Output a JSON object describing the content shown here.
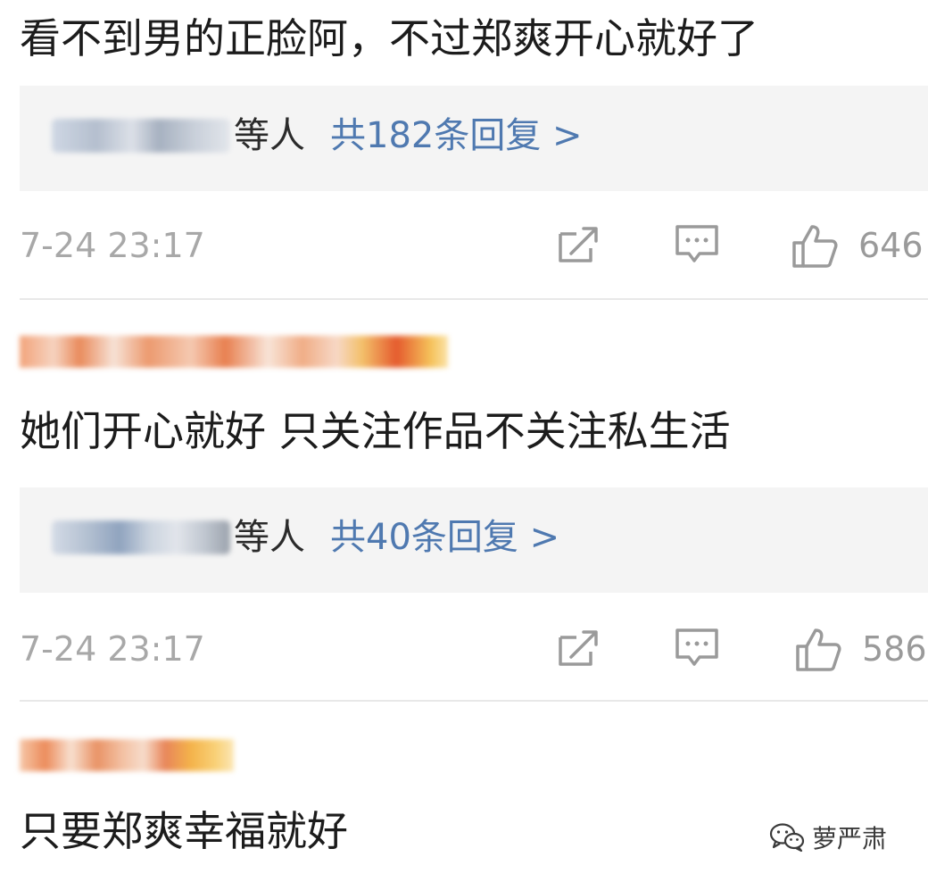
{
  "comments": [
    {
      "text": "看不到男的正脸阿，不过郑爽开心就好了",
      "reply_suffix": "等人",
      "reply_link": "共182条回复 >",
      "timestamp": "7-24 23:17",
      "likes": "646"
    },
    {
      "text": "她们开心就好  只关注作品不关注私生活",
      "reply_suffix": "等人",
      "reply_link": "共40条回复 >",
      "timestamp": "7-24 23:17",
      "likes": "586"
    },
    {
      "text": "只要郑爽幸福就好"
    }
  ],
  "icons": {
    "repost": "repost-icon",
    "comment": "comment-icon",
    "like": "thumbs-up-icon",
    "watermark": "wechat-icon"
  },
  "colors": {
    "link": "#4f79b0",
    "meta": "#a8a8a8",
    "reply_bg": "#f4f4f4"
  },
  "watermark": {
    "label": "萝严肃"
  }
}
